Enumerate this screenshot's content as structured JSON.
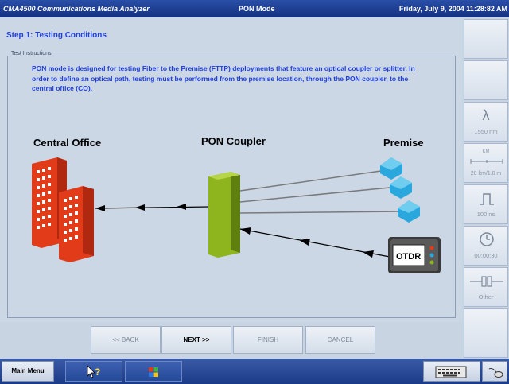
{
  "titlebar": {
    "app_title": "CMA4500 Communications Media Analyzer",
    "mode": "PON Mode",
    "datetime": "Friday, July 9, 2004 11:28:82 AM"
  },
  "step": {
    "title": "Step 1: Testing Conditions"
  },
  "instructions": {
    "legend": "Test Instructions",
    "text": "PON mode is designed for testing Fiber to the Premise (FTTP) deployments that feature an optical coupler or splitter. In order to define an optical path, testing must be performed from the premise location, through the PON coupler, to the central office (CO)."
  },
  "diagram": {
    "central_office_label": "Central Office",
    "pon_coupler_label": "PON Coupler",
    "premise_label": "Premise",
    "otdr_label": "OTDR"
  },
  "nav": {
    "back": "<< BACK",
    "next": "NEXT >>",
    "finish": "FINISH",
    "cancel": "CANCEL"
  },
  "sidebar": {
    "wavelength": "1550 nm",
    "range_unit": "KM",
    "range": "20 km/1.0 m",
    "pulse": "100 ns",
    "time": "00:00:30",
    "other": "Other"
  },
  "taskbar": {
    "main_menu": "Main Menu"
  },
  "icons": [
    "lambda-icon",
    "ruler-icon",
    "pulse-icon",
    "clock-icon",
    "connector-icon",
    "help-icon",
    "windows-icon",
    "keyboard-icon",
    "mouse-icon"
  ]
}
